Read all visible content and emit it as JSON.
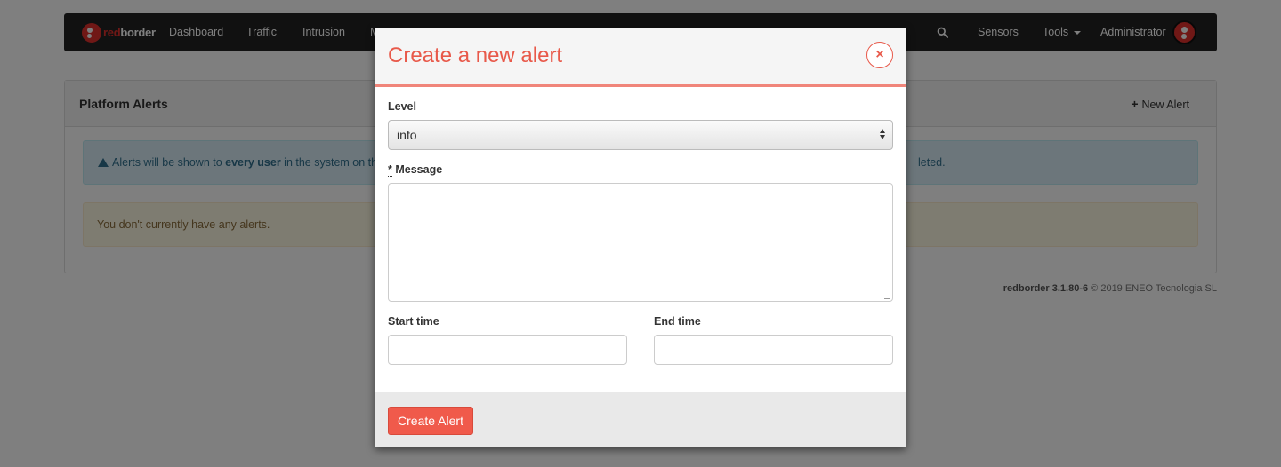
{
  "navbar": {
    "brand_red": "red",
    "brand_white": "border",
    "items": [
      "Dashboard",
      "Traffic",
      "Intrusion",
      "M"
    ],
    "right_items": [
      "Sensors",
      "Tools",
      "Administrator"
    ]
  },
  "panel": {
    "title": "Platform Alerts",
    "new_alert_label": "New Alert",
    "info_prefix": "Alerts will be shown to ",
    "info_bold": "every user",
    "info_suffix_left": " in the system on the",
    "info_suffix_right": "leted.",
    "empty_message": "You don't currently have any alerts."
  },
  "footer": {
    "version": "redborder 3.1.80-6",
    "copyright": "© 2019 ENEO Tecnologia SL"
  },
  "modal": {
    "title": "Create a new alert",
    "close_label": "×",
    "level_label": "Level",
    "level_value": "info",
    "message_required_mark": "*",
    "message_label": " Message",
    "message_value": "",
    "start_time_label": "Start time",
    "start_time_value": "",
    "end_time_label": "End time",
    "end_time_value": "",
    "submit_label": "Create Alert"
  },
  "colors": {
    "accent": "#e8594a",
    "button": "#f05a4b",
    "navbar": "#222222",
    "brand_red": "#e0312d"
  }
}
